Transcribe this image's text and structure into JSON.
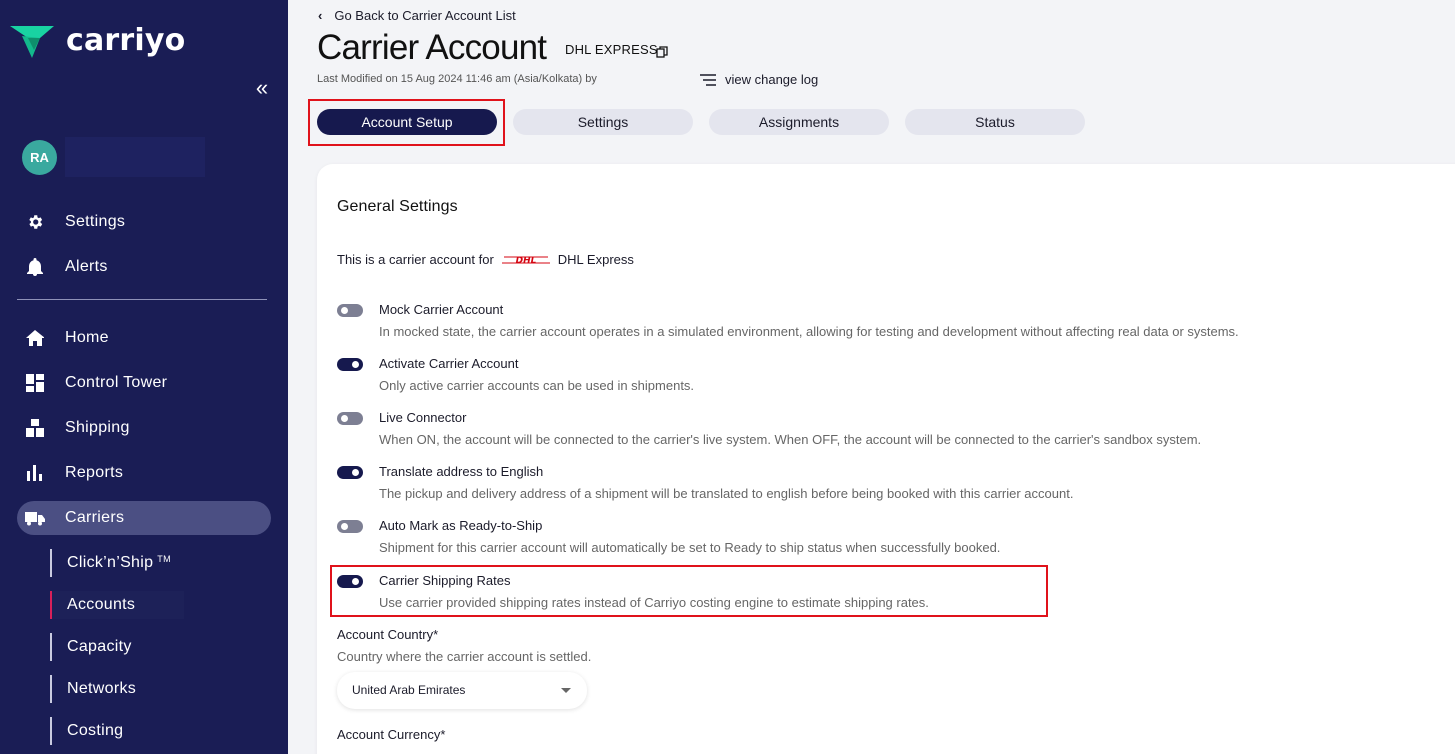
{
  "brand": {
    "name": "carriyo",
    "accent": "#1a1d55",
    "logo_green": "#19d3a2"
  },
  "user": {
    "initials": "RA"
  },
  "sidebar": {
    "top_items": [
      {
        "label": "Settings",
        "icon": "gear-icon"
      },
      {
        "label": "Alerts",
        "icon": "bell-icon"
      }
    ],
    "items": [
      {
        "label": "Home",
        "icon": "home-icon"
      },
      {
        "label": "Control Tower",
        "icon": "dashboard-icon"
      },
      {
        "label": "Shipping",
        "icon": "boxes-icon"
      },
      {
        "label": "Reports",
        "icon": "bar-chart-icon"
      },
      {
        "label": "Carriers",
        "icon": "truck-icon",
        "active": true
      }
    ],
    "sub_items": [
      {
        "label": "Click’n’Ship",
        "sup": "TM"
      },
      {
        "label": "Accounts",
        "active": true
      },
      {
        "label": "Capacity"
      },
      {
        "label": "Networks"
      },
      {
        "label": "Costing"
      }
    ]
  },
  "header": {
    "back_label": "Go Back to Carrier Account List",
    "title": "Carrier Account",
    "carrier_name": "DHL EXPRESS",
    "last_modified": "Last Modified on 15 Aug 2024 11:46 am (Asia/Kolkata) by",
    "change_log_label": "view change log"
  },
  "tabs": [
    {
      "label": "Account Setup",
      "active": true
    },
    {
      "label": "Settings"
    },
    {
      "label": "Assignments"
    },
    {
      "label": "Status"
    }
  ],
  "general": {
    "title": "General Settings",
    "carrier_intro": "This is a carrier account for",
    "carrier_logo_text": "DHL",
    "carrier_display": "DHL Express",
    "options": [
      {
        "label": "Mock Carrier Account",
        "desc": "In mocked state, the carrier account operates in a simulated environment, allowing for testing and development without affecting real data or systems.",
        "on": false
      },
      {
        "label": "Activate Carrier Account",
        "desc": "Only active carrier accounts can be used in shipments.",
        "on": true
      },
      {
        "label": "Live Connector",
        "desc": "When ON, the account will be connected to the carrier's live system. When OFF, the account will be connected to the carrier's sandbox system.",
        "on": false
      },
      {
        "label": "Translate address to English",
        "desc": "The pickup and delivery address of a shipment will be translated to english before being booked with this carrier account.",
        "on": true
      },
      {
        "label": "Auto Mark as Ready-to-Ship",
        "desc": "Shipment for this carrier account will automatically be set to Ready to ship status when successfully booked.",
        "on": false
      },
      {
        "label": "Carrier Shipping Rates",
        "desc": "Use carrier provided shipping rates instead of Carriyo costing engine to estimate shipping rates.",
        "on": true
      }
    ],
    "account_country": {
      "label": "Account Country*",
      "help": "Country where the carrier account is settled.",
      "value": "United Arab Emirates"
    },
    "account_currency": {
      "label": "Account Currency*"
    }
  },
  "highlight_color": "#e0121b"
}
